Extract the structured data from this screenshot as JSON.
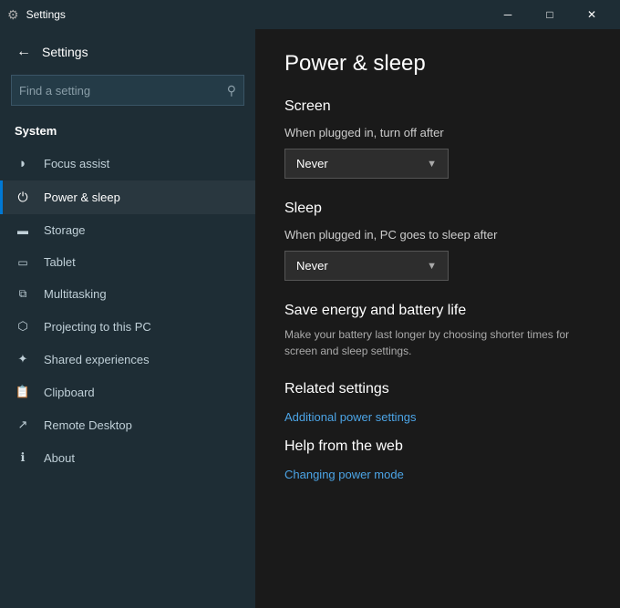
{
  "titleBar": {
    "title": "Settings",
    "minBtn": "─",
    "maxBtn": "□",
    "closeBtn": "✕"
  },
  "sidebar": {
    "backArrow": "←",
    "appTitle": "Settings",
    "searchPlaceholder": "Find a setting",
    "searchIcon": "🔍",
    "sectionTitle": "System",
    "navItems": [
      {
        "id": "focus-assist",
        "icon": "🌙",
        "label": "Focus assist"
      },
      {
        "id": "power-sleep",
        "icon": "⏻",
        "label": "Power & sleep",
        "active": true
      },
      {
        "id": "storage",
        "icon": "▭",
        "label": "Storage"
      },
      {
        "id": "tablet",
        "icon": "⬜",
        "label": "Tablet"
      },
      {
        "id": "multitasking",
        "icon": "⧉",
        "label": "Multitasking"
      },
      {
        "id": "projecting",
        "icon": "⬡",
        "label": "Projecting to this PC"
      },
      {
        "id": "shared-experiences",
        "icon": "⟳",
        "label": "Shared experiences"
      },
      {
        "id": "clipboard",
        "icon": "📋",
        "label": "Clipboard"
      },
      {
        "id": "remote-desktop",
        "icon": "↗",
        "label": "Remote Desktop"
      },
      {
        "id": "about",
        "icon": "ℹ",
        "label": "About"
      }
    ]
  },
  "content": {
    "pageTitle": "Power & sleep",
    "screen": {
      "heading": "Screen",
      "label": "When plugged in, turn off after",
      "dropdownValue": "Never"
    },
    "sleep": {
      "heading": "Sleep",
      "label": "When plugged in, PC goes to sleep after",
      "dropdownValue": "Never"
    },
    "promo": {
      "title": "Save energy and battery life",
      "description": "Make your battery last longer by choosing shorter times for screen and sleep settings."
    },
    "relatedSettings": {
      "heading": "Related settings",
      "links": [
        "Additional power settings"
      ]
    },
    "helpWeb": {
      "heading": "Help from the web",
      "links": [
        "Changing power mode"
      ]
    }
  }
}
